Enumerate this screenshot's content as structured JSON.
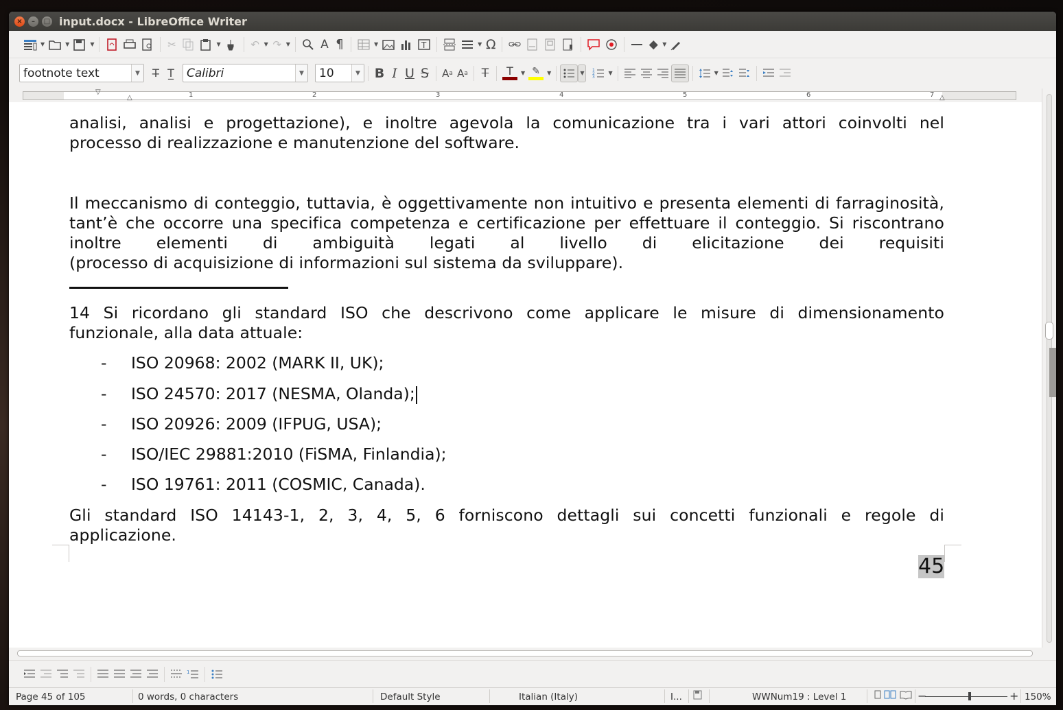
{
  "window": {
    "title": "input.docx - LibreOffice Writer",
    "close_glyph": "×",
    "minimize_glyph": "–",
    "maximize_glyph": "□"
  },
  "toolbar_standard": {
    "icons": [
      "sidebar-icon",
      "open-icon",
      "save-icon",
      "export-pdf-icon",
      "print-icon",
      "print-preview-icon",
      "cut-icon",
      "copy-icon",
      "paste-icon",
      "clone-formatting-icon",
      "undo-icon",
      "redo-icon",
      "find-replace-icon",
      "spelling-icon",
      "formatting-marks-icon",
      "table-icon",
      "image-icon",
      "chart-icon",
      "textbox-icon",
      "page-break-icon",
      "field-icon",
      "special-character-icon",
      "hyperlink-icon",
      "footnote-icon",
      "endnote-icon",
      "bookmark-icon",
      "comment-icon",
      "track-changes-icon",
      "line-icon",
      "shapes-icon",
      "draw-icon"
    ]
  },
  "toolbar_formatting": {
    "paragraph_style": "footnote text",
    "font_name": "Calibri",
    "font_size": "10",
    "bold_label": "B",
    "italic_label": "I",
    "underline_label": "U",
    "strike_label": "S",
    "font_color": "#8b0000",
    "highlight_color": "#ffff00"
  },
  "ruler": {
    "numbers": [
      "1",
      "2",
      "3",
      "4",
      "5",
      "6",
      "7"
    ]
  },
  "document": {
    "para_top": "analisi, analisi e progettazione), e inoltre agevola la comunicazione tra i vari attori coinvolti nel",
    "para_top_last": "processo di realizzazione e manutenzione del software.",
    "para_main": "Il meccanismo di conteggio, tuttavia, è oggettivamente non intuitivo e presenta elementi di farraginosità, tant’è che occorre una specifica competenza e certificazione per effettuare il conteggio. Si riscontrano inoltre elementi di ambiguità legati al livello di elicitazione dei requisiti",
    "para_main_last": "(processo di acquisizione di informazioni sul sistema da sviluppare).",
    "footnote_intro": "14 Si ricordano gli standard ISO che descrivono come applicare le misure di dimensionamento",
    "footnote_intro_last": "funzionale, alla data attuale:",
    "list_dash": "-",
    "list_items": [
      "ISO 20968: 2002 (MARK II, UK);",
      "ISO 24570: 2017 (NESMA, Olanda);",
      "ISO 20926: 2009 (IFPUG, USA);",
      "ISO/IEC 29881:2010 (FiSMA, Finlandia);",
      "ISO 19761: 2011 (COSMIC, Canada)."
    ],
    "footnote_outro": "Gli standard ISO 14143-1, 2, 3, 4, 5, 6 forniscono dettagli sui concetti funzionali e regole di",
    "footnote_outro_last": "applicazione.",
    "page_number": "45"
  },
  "statusbar": {
    "page": "Page 45 of 105",
    "words": "0 words, 0 characters",
    "page_style": "Default Style",
    "language": "Italian (Italy)",
    "insert_mode": "I...",
    "list_level": "WWNum19 : Level 1",
    "zoom": "150%",
    "zoom_minus": "−",
    "zoom_plus": "+"
  }
}
